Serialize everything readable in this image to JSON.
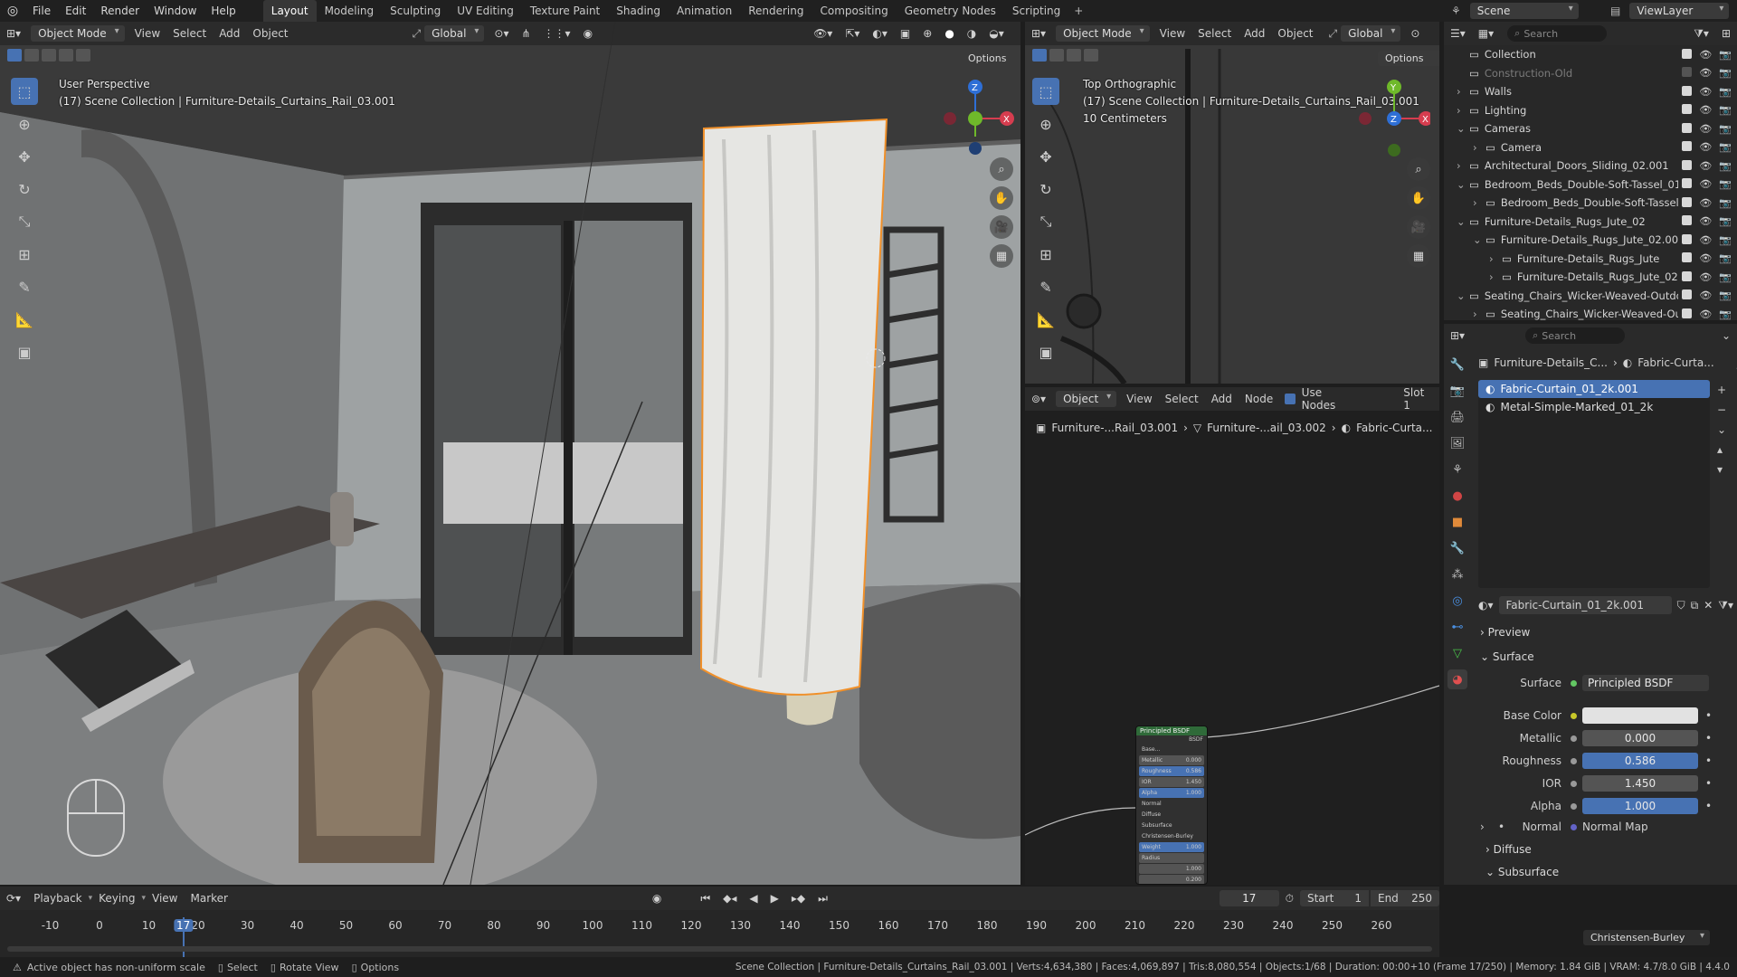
{
  "menu": {
    "items": [
      "File",
      "Edit",
      "Render",
      "Window",
      "Help"
    ]
  },
  "workspaces": {
    "tabs": [
      "Layout",
      "Modeling",
      "Sculpting",
      "UV Editing",
      "Texture Paint",
      "Shading",
      "Animation",
      "Rendering",
      "Compositing",
      "Geometry Nodes",
      "Scripting"
    ],
    "active": "Layout"
  },
  "topright": {
    "scene": "Scene",
    "view_layer": "ViewLayer"
  },
  "viewport_left": {
    "mode": "Object Mode",
    "menus": [
      "View",
      "Select",
      "Add",
      "Object"
    ],
    "orientation": "Global",
    "options": "Options",
    "overlay_line1": "User Perspective",
    "overlay_line2": "(17) Scene Collection | Furniture-Details_Curtains_Rail_03.001"
  },
  "viewport_right": {
    "mode": "Object Mode",
    "menus": [
      "View",
      "Select",
      "Add",
      "Object"
    ],
    "orientation": "Global",
    "options": "Options",
    "overlay_line1": "Top Orthographic",
    "overlay_line2": "(17) Scene Collection | Furniture-Details_Curtains_Rail_03.001",
    "overlay_line3": "10 Centimeters"
  },
  "node_editor": {
    "type": "Object",
    "menus": [
      "View",
      "Select",
      "Add",
      "Node"
    ],
    "use_nodes": "Use Nodes",
    "slot": "Slot 1",
    "breadcrumb": [
      "Furniture-...Rail_03.001",
      "Furniture-...ail_03.002",
      "Fabric-Curta..."
    ],
    "node_title": "Principled BSDF",
    "node_out": "BSDF",
    "node_rows": [
      {
        "label": "Base...",
        "value": ""
      },
      {
        "label": "Metallic",
        "value": "0.000"
      },
      {
        "label": "Roughness",
        "value": "0.586"
      },
      {
        "label": "IOR",
        "value": "1.450"
      },
      {
        "label": "Alpha",
        "value": "1.000"
      },
      {
        "label": "Normal",
        "value": ""
      },
      {
        "label": "Diffuse",
        "value": ""
      },
      {
        "label": "Subsurface",
        "value": ""
      },
      {
        "label": "Christensen-Burley",
        "value": ""
      },
      {
        "label": "Weight",
        "value": "1.000"
      },
      {
        "label": "Radius",
        "value": ""
      },
      {
        "label": "",
        "value": "1.000"
      },
      {
        "label": "",
        "value": "0.200"
      }
    ]
  },
  "outliner": {
    "search_placeholder": "Search",
    "rows": [
      {
        "indent": 0,
        "label": "Collection",
        "arrow": ""
      },
      {
        "indent": 0,
        "label": "Construction-Old",
        "arrow": "",
        "dim": true
      },
      {
        "indent": 0,
        "label": "Walls",
        "arrow": "›"
      },
      {
        "indent": 0,
        "label": "Lighting",
        "arrow": "›"
      },
      {
        "indent": 0,
        "label": "Cameras",
        "arrow": "⌄"
      },
      {
        "indent": 1,
        "label": "Camera",
        "arrow": "›"
      },
      {
        "indent": 0,
        "label": "Architectural_Doors_Sliding_02.001",
        "arrow": "›"
      },
      {
        "indent": 0,
        "label": "Bedroom_Beds_Double-Soft-Tassel_01.",
        "arrow": "⌄"
      },
      {
        "indent": 1,
        "label": "Bedroom_Beds_Double-Soft-Tassel_",
        "arrow": "›"
      },
      {
        "indent": 0,
        "label": "Furniture-Details_Rugs_Jute_02",
        "arrow": "⌄"
      },
      {
        "indent": 1,
        "label": "Furniture-Details_Rugs_Jute_02.001",
        "arrow": "⌄"
      },
      {
        "indent": 2,
        "label": "Furniture-Details_Rugs_Jute",
        "arrow": "›"
      },
      {
        "indent": 2,
        "label": "Furniture-Details_Rugs_Jute_02.",
        "arrow": "›"
      },
      {
        "indent": 0,
        "label": "Seating_Chairs_Wicker-Weaved-Outdo",
        "arrow": "⌄"
      },
      {
        "indent": 1,
        "label": "Seating_Chairs_Wicker-Weaved-Ou",
        "arrow": "›"
      }
    ]
  },
  "properties": {
    "search_placeholder": "Search",
    "breadcrumb_object": "Furniture-Details_C...",
    "breadcrumb_material": "Fabric-Curta...",
    "slots": [
      "Fabric-Curtain_01_2k.001",
      "Metal-Simple-Marked_01_2k"
    ],
    "material_name": "Fabric-Curtain_01_2k.001",
    "preview": "Preview",
    "surface_section": "Surface",
    "surface_label": "Surface",
    "surface_value": "Principled BSDF",
    "base_color_label": "Base Color",
    "metallic_label": "Metallic",
    "metallic_value": "0.000",
    "roughness_label": "Roughness",
    "roughness_value": "0.586",
    "ior_label": "IOR",
    "ior_value": "1.450",
    "alpha_label": "Alpha",
    "alpha_value": "1.000",
    "normal_label": "Normal",
    "normal_value": "Normal Map",
    "diffuse": "Diffuse",
    "subsurface": "Subsurface",
    "subsurface_method": "Christensen-Burley"
  },
  "timeline": {
    "menus": [
      "Playback",
      "Keying",
      "View",
      "Marker"
    ],
    "current_frame": "17",
    "start_label": "Start",
    "start_value": "1",
    "end_label": "End",
    "end_value": "250",
    "ticks": [
      "-10",
      "0",
      "10",
      "17",
      "20",
      "30",
      "40",
      "50",
      "60",
      "70",
      "80",
      "90",
      "100",
      "110",
      "120",
      "130",
      "140",
      "150",
      "160",
      "170",
      "180",
      "190",
      "200",
      "210",
      "220",
      "230",
      "240",
      "250",
      "260"
    ]
  },
  "statusbar": {
    "warning": "Active object has non-uniform scale",
    "hints": [
      "Select",
      "Rotate View",
      "Options"
    ],
    "stats": "Scene Collection | Furniture-Details_Curtains_Rail_03.001 | Verts:4,634,380 | Faces:4,069,897 | Tris:8,080,554 | Objects:1/68 | Duration: 00:00+10 (Frame 17/250) | Memory: 1.84 GiB | VRAM: 4.7/8.0 GiB | 4.4.0"
  }
}
